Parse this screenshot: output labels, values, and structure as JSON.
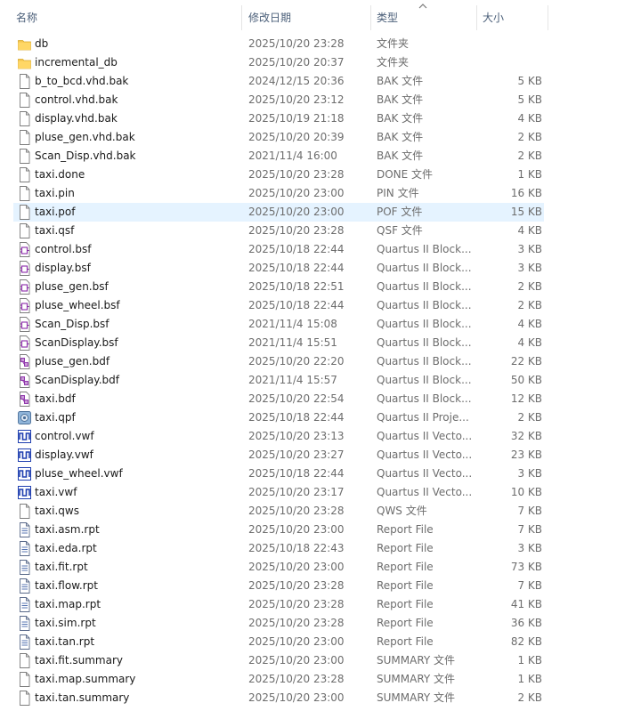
{
  "header": {
    "name": "名称",
    "date": "修改日期",
    "type": "类型",
    "size": "大小"
  },
  "files": [
    {
      "name": "db",
      "date": "2025/10/20 23:28",
      "type": "文件夹",
      "size": "",
      "icon": "folder-icon"
    },
    {
      "name": "incremental_db",
      "date": "2025/10/20 20:37",
      "type": "文件夹",
      "size": "",
      "icon": "folder-icon"
    },
    {
      "name": "b_to_bcd.vhd.bak",
      "date": "2024/12/15 20:36",
      "type": "BAK 文件",
      "size": "5 KB",
      "icon": "file-icon"
    },
    {
      "name": "control.vhd.bak",
      "date": "2025/10/20 23:12",
      "type": "BAK 文件",
      "size": "5 KB",
      "icon": "file-icon"
    },
    {
      "name": "display.vhd.bak",
      "date": "2025/10/19 21:18",
      "type": "BAK 文件",
      "size": "4 KB",
      "icon": "file-icon"
    },
    {
      "name": "pluse_gen.vhd.bak",
      "date": "2025/10/20 20:39",
      "type": "BAK 文件",
      "size": "2 KB",
      "icon": "file-icon"
    },
    {
      "name": "Scan_Disp.vhd.bak",
      "date": "2021/11/4 16:00",
      "type": "BAK 文件",
      "size": "2 KB",
      "icon": "file-icon"
    },
    {
      "name": "taxi.done",
      "date": "2025/10/20 23:28",
      "type": "DONE 文件",
      "size": "1 KB",
      "icon": "file-icon"
    },
    {
      "name": "taxi.pin",
      "date": "2025/10/20 23:00",
      "type": "PIN 文件",
      "size": "16 KB",
      "icon": "file-icon"
    },
    {
      "name": "taxi.pof",
      "date": "2025/10/20 23:00",
      "type": "POF 文件",
      "size": "15 KB",
      "icon": "file-icon",
      "selected": true
    },
    {
      "name": "taxi.qsf",
      "date": "2025/10/20 23:28",
      "type": "QSF 文件",
      "size": "4 KB",
      "icon": "file-icon"
    },
    {
      "name": "control.bsf",
      "date": "2025/10/18 22:44",
      "type": "Quartus II Block...",
      "size": "3 KB",
      "icon": "bsf-icon"
    },
    {
      "name": "display.bsf",
      "date": "2025/10/18 22:44",
      "type": "Quartus II Block...",
      "size": "3 KB",
      "icon": "bsf-icon"
    },
    {
      "name": "pluse_gen.bsf",
      "date": "2025/10/18 22:51",
      "type": "Quartus II Block...",
      "size": "2 KB",
      "icon": "bsf-icon"
    },
    {
      "name": "pluse_wheel.bsf",
      "date": "2025/10/18 22:44",
      "type": "Quartus II Block...",
      "size": "2 KB",
      "icon": "bsf-icon"
    },
    {
      "name": "Scan_Disp.bsf",
      "date": "2021/11/4 15:08",
      "type": "Quartus II Block...",
      "size": "4 KB",
      "icon": "bsf-icon"
    },
    {
      "name": "ScanDisplay.bsf",
      "date": "2021/11/4 15:51",
      "type": "Quartus II Block...",
      "size": "4 KB",
      "icon": "bsf-icon"
    },
    {
      "name": "pluse_gen.bdf",
      "date": "2025/10/20 22:20",
      "type": "Quartus II Block...",
      "size": "22 KB",
      "icon": "bdf-icon"
    },
    {
      "name": "ScanDisplay.bdf",
      "date": "2021/11/4 15:57",
      "type": "Quartus II Block...",
      "size": "50 KB",
      "icon": "bdf-icon"
    },
    {
      "name": "taxi.bdf",
      "date": "2025/10/20 22:54",
      "type": "Quartus II Block...",
      "size": "12 KB",
      "icon": "bdf-icon"
    },
    {
      "name": "taxi.qpf",
      "date": "2025/10/18 22:44",
      "type": "Quartus II Proje...",
      "size": "2 KB",
      "icon": "qpf-icon"
    },
    {
      "name": "control.vwf",
      "date": "2025/10/20 23:13",
      "type": "Quartus II Vecto...",
      "size": "32 KB",
      "icon": "vwf-icon"
    },
    {
      "name": "display.vwf",
      "date": "2025/10/20 23:27",
      "type": "Quartus II Vecto...",
      "size": "23 KB",
      "icon": "vwf-icon"
    },
    {
      "name": "pluse_wheel.vwf",
      "date": "2025/10/18 22:44",
      "type": "Quartus II Vecto...",
      "size": "3 KB",
      "icon": "vwf-icon"
    },
    {
      "name": "taxi.vwf",
      "date": "2025/10/20 23:17",
      "type": "Quartus II Vecto...",
      "size": "10 KB",
      "icon": "vwf-icon"
    },
    {
      "name": "taxi.qws",
      "date": "2025/10/20 23:28",
      "type": "QWS 文件",
      "size": "7 KB",
      "icon": "file-icon"
    },
    {
      "name": "taxi.asm.rpt",
      "date": "2025/10/20 23:00",
      "type": "Report File",
      "size": "7 KB",
      "icon": "report-icon"
    },
    {
      "name": "taxi.eda.rpt",
      "date": "2025/10/18 22:43",
      "type": "Report File",
      "size": "3 KB",
      "icon": "report-icon"
    },
    {
      "name": "taxi.fit.rpt",
      "date": "2025/10/20 23:00",
      "type": "Report File",
      "size": "73 KB",
      "icon": "report-icon"
    },
    {
      "name": "taxi.flow.rpt",
      "date": "2025/10/20 23:28",
      "type": "Report File",
      "size": "7 KB",
      "icon": "report-icon"
    },
    {
      "name": "taxi.map.rpt",
      "date": "2025/10/20 23:28",
      "type": "Report File",
      "size": "41 KB",
      "icon": "report-icon"
    },
    {
      "name": "taxi.sim.rpt",
      "date": "2025/10/20 23:28",
      "type": "Report File",
      "size": "36 KB",
      "icon": "report-icon"
    },
    {
      "name": "taxi.tan.rpt",
      "date": "2025/10/20 23:00",
      "type": "Report File",
      "size": "82 KB",
      "icon": "report-icon"
    },
    {
      "name": "taxi.fit.summary",
      "date": "2025/10/20 23:00",
      "type": "SUMMARY 文件",
      "size": "1 KB",
      "icon": "file-icon"
    },
    {
      "name": "taxi.map.summary",
      "date": "2025/10/20 23:28",
      "type": "SUMMARY 文件",
      "size": "1 KB",
      "icon": "file-icon"
    },
    {
      "name": "taxi.tan.summary",
      "date": "2025/10/20 23:00",
      "type": "SUMMARY 文件",
      "size": "2 KB",
      "icon": "file-icon"
    }
  ],
  "colors": {
    "header_text": "#4c607a",
    "selection": "#e5f3ff",
    "folder": "#f5c64f",
    "vwf_blue": "#1f3fb0",
    "bsf_purple": "#8a2aa8"
  }
}
